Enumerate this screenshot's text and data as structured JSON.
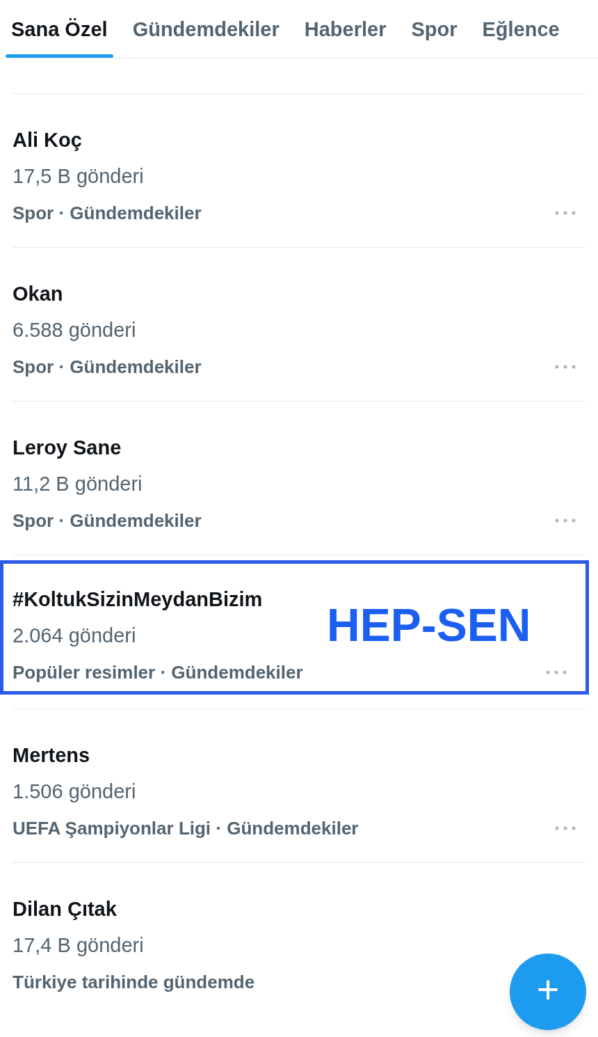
{
  "tabs": [
    {
      "label": "Sana Özel",
      "selected": true
    },
    {
      "label": "Gündemdekiler",
      "selected": false
    },
    {
      "label": "Haberler",
      "selected": false
    },
    {
      "label": "Spor",
      "selected": false
    },
    {
      "label": "Eğlence",
      "selected": false
    }
  ],
  "trends": [
    {
      "title": "Ali Koç",
      "count": "17,5 B gönderi",
      "category": "Spor · Gündemdekiler",
      "highlighted": false,
      "has_menu": true
    },
    {
      "title": "Okan",
      "count": "6.588 gönderi",
      "category": "Spor · Gündemdekiler",
      "highlighted": false,
      "has_menu": true
    },
    {
      "title": "Leroy Sane",
      "count": "11,2 B gönderi",
      "category": "Spor · Gündemdekiler",
      "highlighted": false,
      "has_menu": true
    },
    {
      "title": "#KoltukSizinMeydanBizim",
      "count": "2.064 gönderi",
      "category": "Popüler resimler · Gündemdekiler",
      "highlighted": true,
      "annotation": "HEP-SEN",
      "has_menu": true
    },
    {
      "title": "Mertens",
      "count": "1.506 gönderi",
      "category": "UEFA Şampiyonlar Ligi · Gündemdekiler",
      "highlighted": false,
      "has_menu": true
    },
    {
      "title": "Dilan Çıtak",
      "count": "17,4 B gönderi",
      "category": "Türkiye tarihinde gündemde",
      "highlighted": false,
      "has_menu": false
    }
  ],
  "compose_button": {
    "label": "+"
  }
}
